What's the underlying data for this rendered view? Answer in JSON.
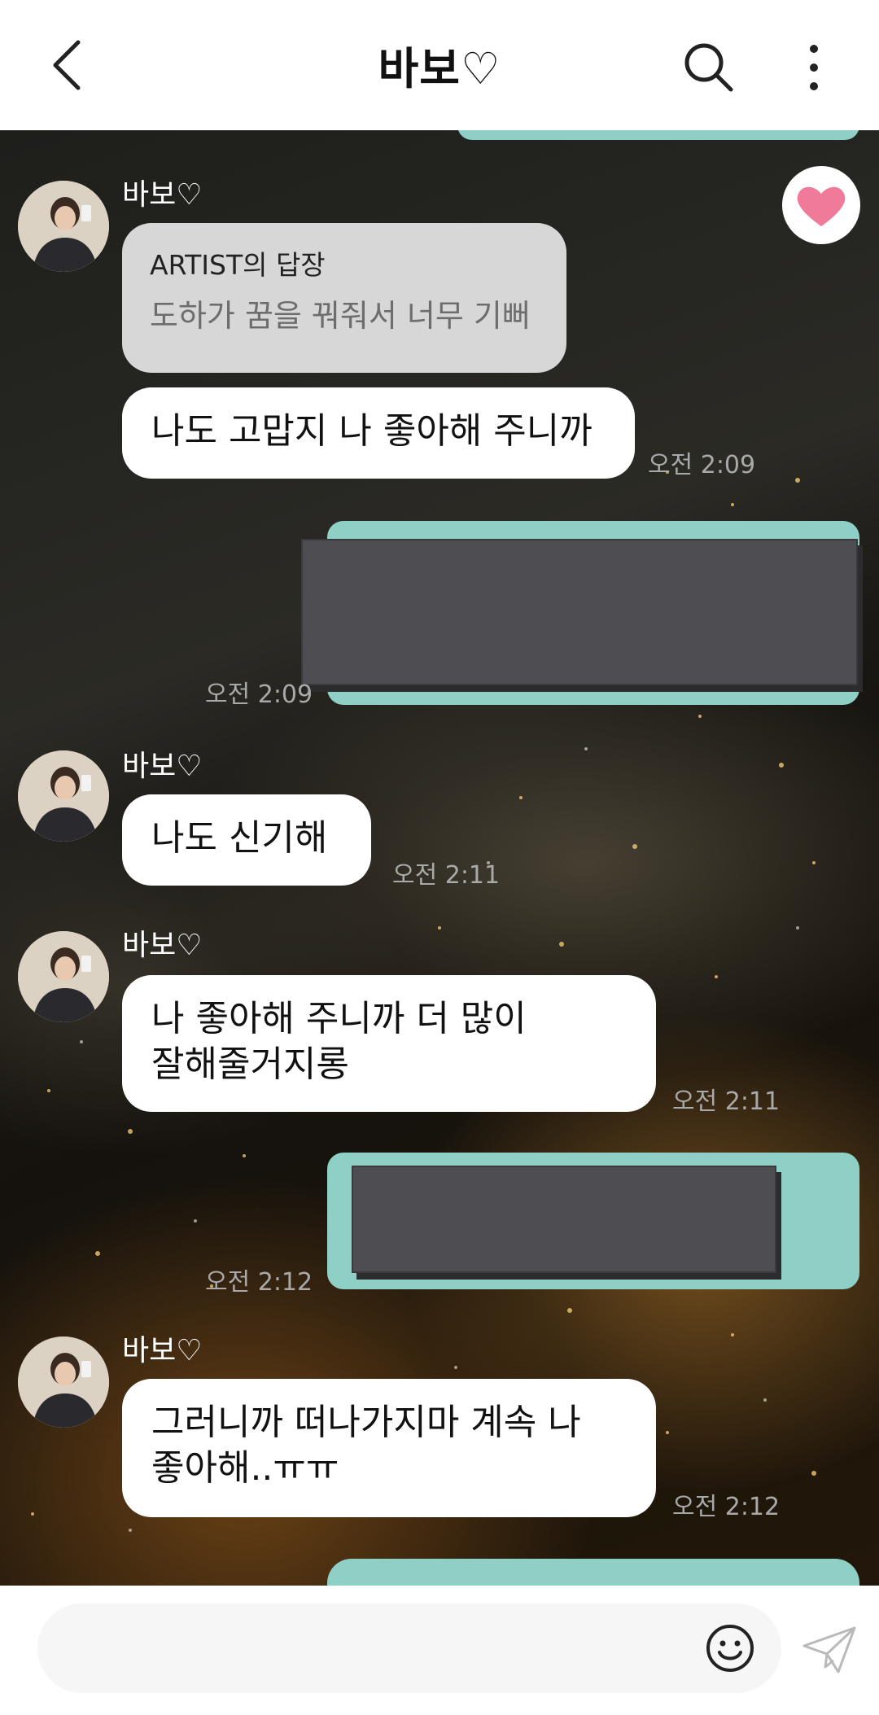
{
  "header": {
    "title": "바보♡",
    "back_icon": "chevron-left-icon",
    "search_icon": "search-icon",
    "more_icon": "more-vertical-icon"
  },
  "messages": [
    {
      "sender": "바보♡",
      "reply_header": "ARTIST의 답장",
      "reply_text": "도하가 꿈을 꿔줘서 너무 기뻐",
      "text": "나도 고맙지 나 좋아해 주니까",
      "time": "오전 2:09"
    },
    {
      "time": "오전 2:09"
    },
    {
      "sender": "바보♡",
      "text": "나도 신기해",
      "time": "오전 2:11"
    },
    {
      "sender": "바보♡",
      "lines": [
        "나 좋아해 주니까 더 많이",
        "잘해줄거지롱"
      ],
      "time": "오전 2:11"
    },
    {
      "time": "오전 2:12"
    },
    {
      "sender": "바보♡",
      "lines": [
        "그러니까 떠나가지마 계속 나",
        "좋아해..ㅠㅠ"
      ],
      "time": "오전 2:12"
    }
  ],
  "like_icon": "heart-icon",
  "footer": {
    "input_placeholder": "",
    "emoji_icon": "smiley-icon",
    "send_icon": "send-plane-icon"
  },
  "colors": {
    "header_bg": "#ffffff",
    "my_bubble": "#8fd0c6",
    "their_bubble": "#ffffff",
    "reply_bubble": "#d7d7d7",
    "heart": "#f07a9a",
    "time_text": "#a9a9a9"
  }
}
